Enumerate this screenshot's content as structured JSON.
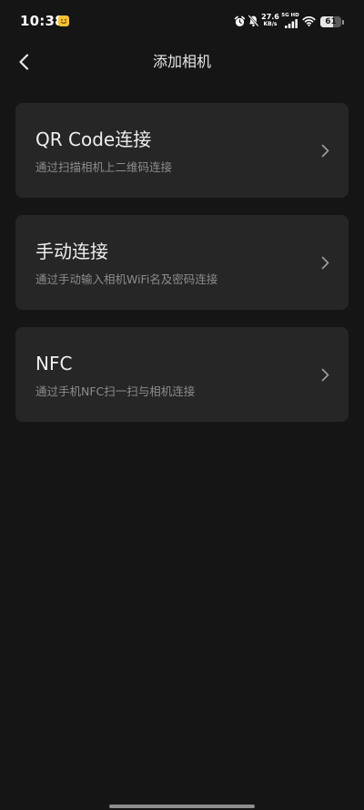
{
  "status_bar": {
    "time": "10:38",
    "net_speed_value": "27.6",
    "net_speed_unit": "KB/s",
    "network_label": "5G HD",
    "battery_level": "61"
  },
  "header": {
    "title": "添加相机"
  },
  "options": [
    {
      "title": "QR Code连接",
      "subtitle": "通过扫描相机上二维码连接"
    },
    {
      "title": "手动连接",
      "subtitle": "通过手动输入相机WiFi名及密码连接"
    },
    {
      "title": "NFC",
      "subtitle": "通过手机NFC扫一扫与相机连接"
    }
  ],
  "icons": {
    "app_notification": "smiley-app-icon",
    "alarm": "alarm-icon",
    "silent": "bell-off-icon",
    "signal": "cellular-signal-icon",
    "wifi": "wifi-icon",
    "battery": "battery-icon",
    "back": "chevron-left-icon",
    "option_arrow": "chevron-right-icon"
  },
  "colors": {
    "background": "#151515",
    "card": "#262626",
    "title_text": "#eeeeee",
    "subtitle_text": "#8c8c8c",
    "chevron": "#9a9a9a",
    "app_badge": "#f4c233",
    "home_indicator": "#8e8e8e"
  }
}
